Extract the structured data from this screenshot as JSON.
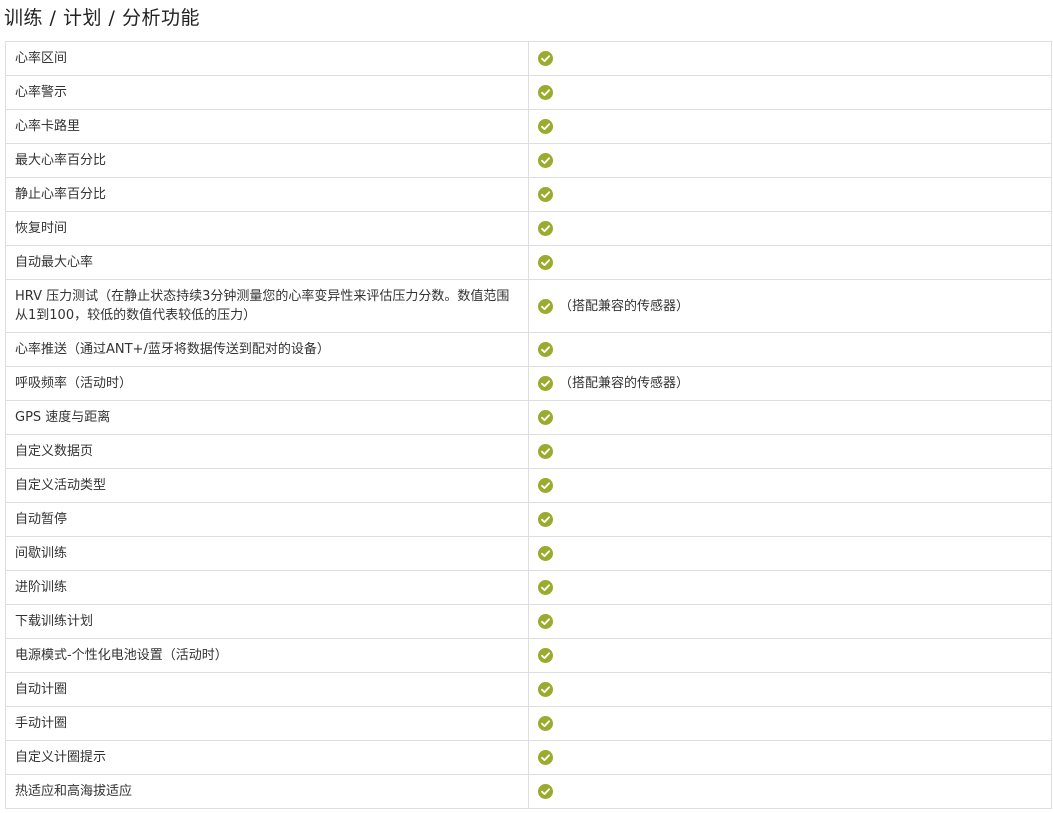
{
  "section": {
    "title": "训练 / 计划 / 分析功能"
  },
  "colors": {
    "check": "#9aab2d",
    "border": "#dedede",
    "text": "#333333"
  },
  "rows": [
    {
      "feature": "心率区间",
      "icon": "check-circle-icon",
      "note": ""
    },
    {
      "feature": "心率警示",
      "icon": "check-circle-icon",
      "note": ""
    },
    {
      "feature": "心率卡路里",
      "icon": "check-circle-icon",
      "note": ""
    },
    {
      "feature": "最大心率百分比",
      "icon": "check-circle-icon",
      "note": ""
    },
    {
      "feature": "静止心率百分比",
      "icon": "check-circle-icon",
      "note": ""
    },
    {
      "feature": "恢复时间",
      "icon": "check-circle-icon",
      "note": ""
    },
    {
      "feature": "自动最大心率",
      "icon": "check-circle-icon",
      "note": ""
    },
    {
      "feature": "HRV 压力测试（在静止状态持续3分钟测量您的心率变异性来评估压力分数。数值范围从1到100，较低的数值代表较低的压力）",
      "icon": "check-circle-icon",
      "note": "（搭配兼容的传感器）"
    },
    {
      "feature": "心率推送（通过ANT+/蓝牙将数据传送到配对的设备）",
      "icon": "check-circle-icon",
      "note": ""
    },
    {
      "feature": "呼吸频率（活动时）",
      "icon": "check-circle-icon",
      "note": "（搭配兼容的传感器）"
    },
    {
      "feature": "GPS 速度与距离",
      "icon": "check-circle-icon",
      "note": ""
    },
    {
      "feature": "自定义数据页",
      "icon": "check-circle-icon",
      "note": ""
    },
    {
      "feature": "自定义活动类型",
      "icon": "check-circle-icon",
      "note": ""
    },
    {
      "feature": "自动暂停",
      "icon": "check-circle-icon",
      "note": ""
    },
    {
      "feature": "间歇训练",
      "icon": "check-circle-icon",
      "note": ""
    },
    {
      "feature": "进阶训练",
      "icon": "check-circle-icon",
      "note": ""
    },
    {
      "feature": "下载训练计划",
      "icon": "check-circle-icon",
      "note": ""
    },
    {
      "feature": "电源模式-个性化电池设置（活动时）",
      "icon": "check-circle-icon",
      "note": ""
    },
    {
      "feature": "自动计圈",
      "icon": "check-circle-icon",
      "note": ""
    },
    {
      "feature": "手动计圈",
      "icon": "check-circle-icon",
      "note": ""
    },
    {
      "feature": "自定义计圈提示",
      "icon": "check-circle-icon",
      "note": ""
    },
    {
      "feature": "热适应和高海拔适应",
      "icon": "check-circle-icon",
      "note": ""
    }
  ]
}
